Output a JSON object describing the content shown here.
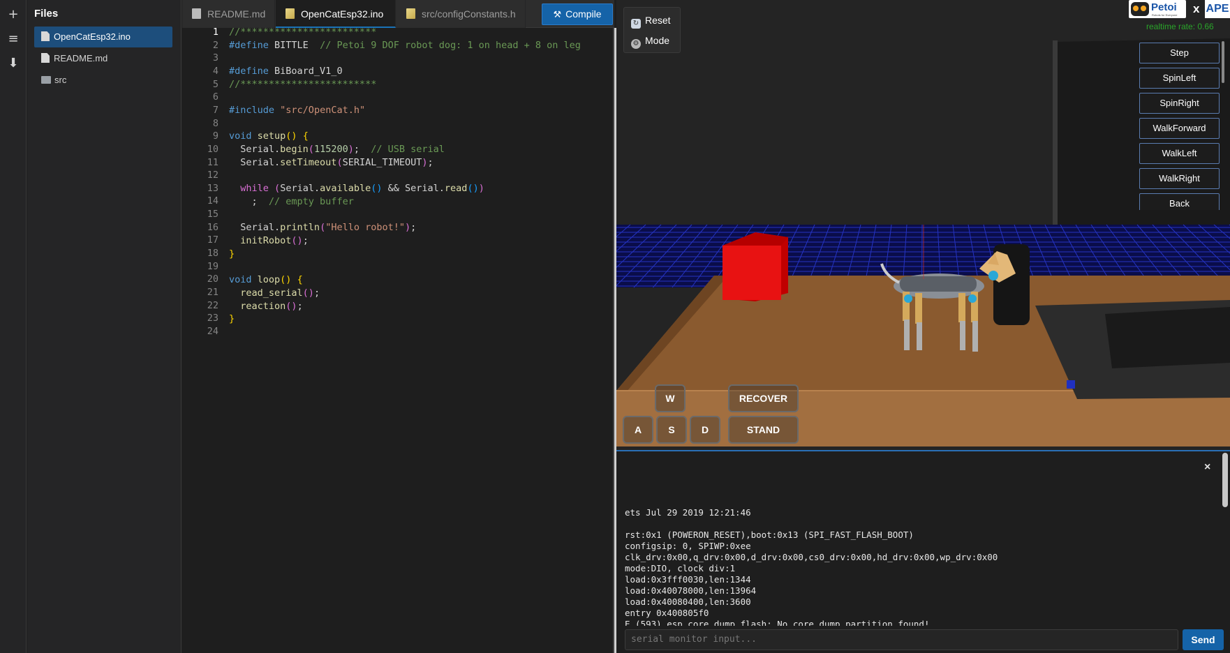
{
  "rail": {
    "add_icon": "+",
    "menu_icon": "≡",
    "download_icon": "⬇"
  },
  "files": {
    "title": "Files",
    "items": [
      {
        "label": "OpenCatEsp32.ino",
        "type": "file",
        "active": true
      },
      {
        "label": "README.md",
        "type": "file",
        "active": false
      },
      {
        "label": "src",
        "type": "folder",
        "active": false
      }
    ]
  },
  "tabs": [
    {
      "label": "README.md",
      "active": false
    },
    {
      "label": "OpenCatEsp32.ino",
      "active": true
    },
    {
      "label": "src/configConstants.h",
      "active": false
    }
  ],
  "compile": {
    "label": "Compile",
    "icon": "hammer-icon"
  },
  "editor": {
    "line_numbers": [
      "1",
      "2",
      "3",
      "4",
      "5",
      "6",
      "7",
      "8",
      "9",
      "10",
      "11",
      "12",
      "13",
      "14",
      "15",
      "16",
      "17",
      "18",
      "19",
      "20",
      "21",
      "22",
      "23",
      "24"
    ],
    "current_line": 1
  },
  "sim": {
    "reset_label": "Reset",
    "mode_label": "Mode",
    "logo_brand": "Petoi",
    "logo_tagline": "Robots for Everyone",
    "logo_x": "x",
    "logo_partner": "APE",
    "realtime_rate": "realtime rate: 0.66",
    "actions": [
      "Step",
      "SpinLeft",
      "SpinRight",
      "WalkForward",
      "WalkLeft",
      "WalkRight",
      "Back"
    ],
    "controls": {
      "w": "W",
      "a": "A",
      "s": "S",
      "d": "D",
      "recover": "RECOVER",
      "stand": "STAND"
    }
  },
  "serial": {
    "close_label": "×",
    "log": [
      "ets Jul 29 2019 12:21:46",
      "",
      "rst:0x1 (POWERON_RESET),boot:0x13 (SPI_FAST_FLASH_BOOT)",
      "configsip: 0, SPIWP:0xee",
      "clk_drv:0x00,q_drv:0x00,d_drv:0x00,cs0_drv:0x00,hd_drv:0x00,wp_drv:0x00",
      "mode:DIO, clock div:1",
      "load:0x3fff0030,len:1344",
      "load:0x40078000,len:13964",
      "load:0x40080400,len:3600",
      "entry 0x400805f0",
      "E (593) esp_core_dump_flash: No core dump partition found!"
    ],
    "input_placeholder": "serial monitor input...",
    "send_label": "Send"
  },
  "colors": {
    "accent": "#1563a8",
    "green_status": "#2aa52a",
    "table_wood": "#8a5a2f",
    "grid_blue": "#1f2fb8",
    "box_red": "#e01010"
  }
}
